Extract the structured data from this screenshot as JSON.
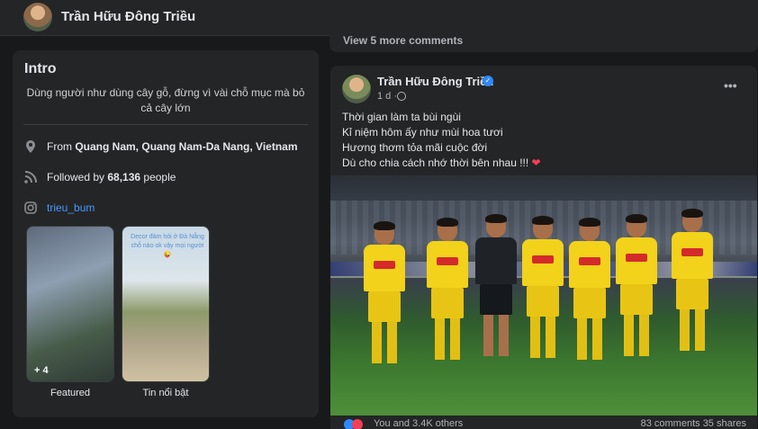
{
  "header": {
    "profile_name": "Trần Hữu Đông Triều",
    "more_label": "•••"
  },
  "comments": {
    "view_more": "View 5 more comments"
  },
  "intro": {
    "title": "Intro",
    "bio": "Dùng người như dùng cây gỗ, đừng vì vài chỗ mục mà bỏ cả cây lớn",
    "location_prefix": "From ",
    "location": "Quang Nam, Quang Nam-Da Nang, Vietnam",
    "followers_prefix": "Followed by ",
    "followers_count": "68,136",
    "followers_suffix": " people",
    "instagram": "trieu_bum",
    "featured": [
      {
        "label": "Featured",
        "count": "+ 4"
      },
      {
        "label": "Tin nổi bật",
        "caption": "Decor đám hỏi ở Đà Nẵng chỗ nào ok vậy mọi người 😜"
      }
    ]
  },
  "post": {
    "author": "Trần Hữu Đông Triều",
    "time": "1 d ·",
    "more_label": "•••",
    "lines": [
      "Thời gian làm ta bùi ngùi",
      "Kỉ niệm hôm ấy như mùi hoa tươi",
      "Hương thơm tỏa mãi cuộc đời",
      "Dù cho chia cách nhớ thời bên nhau !!!"
    ],
    "heart": "❤",
    "reactions_text": "You and 3.4K others",
    "stats_text": "83 comments  35 shares"
  },
  "colors": {
    "background": "#18191a",
    "card": "#242526",
    "link": "#4599ff",
    "verified": "#2d88ff",
    "jersey": "#f2d21a"
  }
}
